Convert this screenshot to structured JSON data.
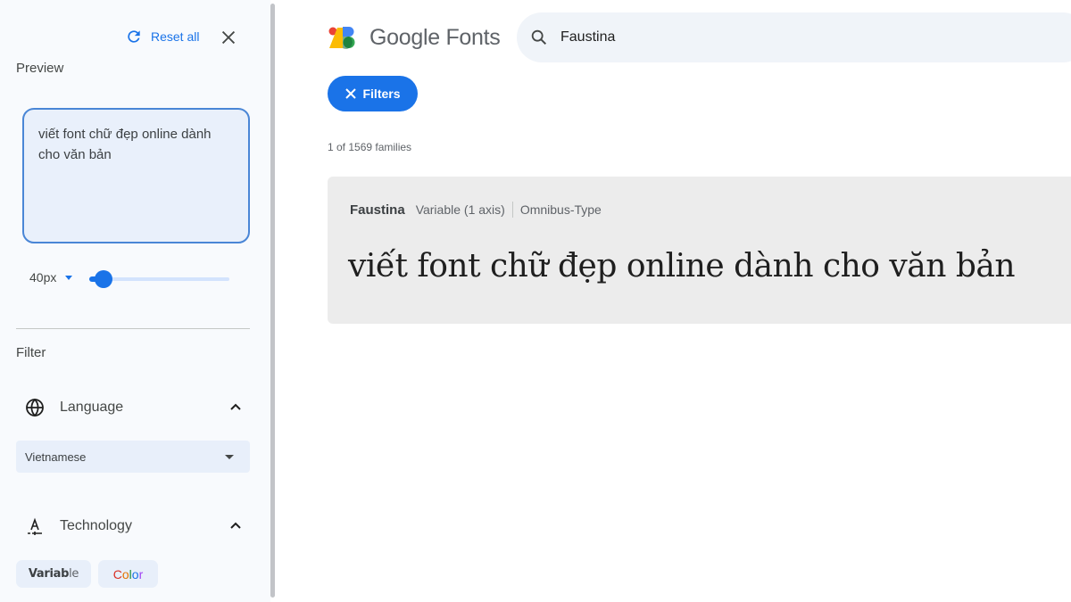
{
  "sidebar": {
    "reset_label": "Reset all",
    "preview_label": "Preview",
    "preview_text": "viết font chữ đẹp online dành cho văn bản",
    "font_size": "40px",
    "font_size_slider_fraction": 0.1,
    "filter_label": "Filter",
    "language": {
      "label": "Language",
      "selected": "Vietnamese"
    },
    "technology": {
      "label": "Technology",
      "chips": [
        {
          "label_bold": "Variab",
          "label_light": "le"
        },
        {
          "label": "Color",
          "letters": [
            "C",
            "o",
            "l",
            "o",
            "r"
          ],
          "colors": [
            "#d93025",
            "#e37400",
            "#1e8e3e",
            "#1a73e8",
            "#a142f4"
          ]
        }
      ]
    }
  },
  "header": {
    "brand": "Google Fonts",
    "search_value": "Faustina",
    "filters_label": "Filters"
  },
  "results": {
    "count": "1 of 1569 families",
    "fonts": [
      {
        "name": "Faustina",
        "axis": "Variable (1 axis)",
        "foundry": "Omnibus-Type",
        "sample": "viết font chữ đẹp online dành cho văn bản"
      }
    ]
  },
  "colors": {
    "accent": "#1a73e8",
    "sidebar_bg": "#f8fafd",
    "card_bg": "#ececec"
  }
}
